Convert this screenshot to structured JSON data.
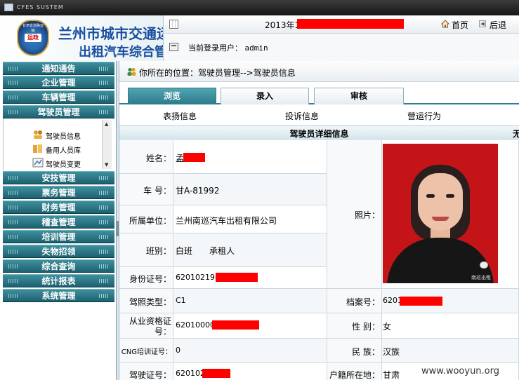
{
  "window": {
    "title": "CFES SUSTEM"
  },
  "header": {
    "logo_text": "运政",
    "logo_rim_text": "甘肃省道路运输",
    "brand_line1": "兰州市城市交通运",
    "brand_line2": "出租汽车综合管",
    "date_prefix": "2013年1",
    "home_label": "首页",
    "back_label": "后退",
    "current_user_label": "当前登录用户：",
    "current_user": "admin"
  },
  "sidebar": {
    "items": [
      {
        "label": "通知通告"
      },
      {
        "label": "企业管理"
      },
      {
        "label": "车辆管理"
      },
      {
        "label": "驾驶员管理"
      },
      {
        "label": "安技管理"
      },
      {
        "label": "票务管理"
      },
      {
        "label": "财务管理"
      },
      {
        "label": "稽查管理"
      },
      {
        "label": "培训管理"
      },
      {
        "label": "失物招领"
      },
      {
        "label": "综合查询"
      },
      {
        "label": "统计报表"
      },
      {
        "label": "系统管理"
      }
    ],
    "submenu": [
      {
        "label": "驾驶员信息"
      },
      {
        "label": "备用人员库"
      },
      {
        "label": "驾驶员变更"
      }
    ]
  },
  "content": {
    "location": "你所在的位置：驾驶员管理-->驾驶员信息",
    "tabs": [
      {
        "label": "浏览"
      },
      {
        "label": "录入"
      },
      {
        "label": "审核"
      }
    ],
    "subtabs": [
      {
        "label": "表扬信息"
      },
      {
        "label": "投诉信息"
      },
      {
        "label": "营运行为"
      }
    ],
    "detail_title": "驾驶员详细信息",
    "detail_edge": "无",
    "fields": {
      "name": {
        "label": "姓名：",
        "value": "孟"
      },
      "plate": {
        "label": "车  号：",
        "value": "甘A-81992"
      },
      "unit": {
        "label": "所属单位：",
        "value": "兰州南巡汽车出租有限公司"
      },
      "shift": {
        "label": "班别：",
        "value": "白班",
        "value2": "承租人"
      },
      "idcard": {
        "label": "身份证号：",
        "value": "6201021985"
      },
      "photo": {
        "label": "照片："
      },
      "license_type": {
        "label": "驾照类型：",
        "value": "C1"
      },
      "archive": {
        "label": "档案号：",
        "value": "6201"
      },
      "qualification": {
        "label_line1": "从业资格证",
        "label_line2": "号：",
        "value": "620100003"
      },
      "gender": {
        "label": "性  别：",
        "value": "女"
      },
      "cng": {
        "label": "CNG培训证号：",
        "value": "0"
      },
      "ethnicity": {
        "label": "民  族：",
        "value": "汉族"
      },
      "license_no": {
        "label": "驾驶证号：",
        "value": "620102"
      },
      "household": {
        "label": "户籍所在地：",
        "value": "甘肃"
      }
    },
    "photo_mark_text": "南巡出租"
  },
  "watermark": "www.wooyun.org",
  "colors": {
    "nav": "#2a7684",
    "redaction": "#ff0000",
    "brand": "#1a4fa0"
  }
}
